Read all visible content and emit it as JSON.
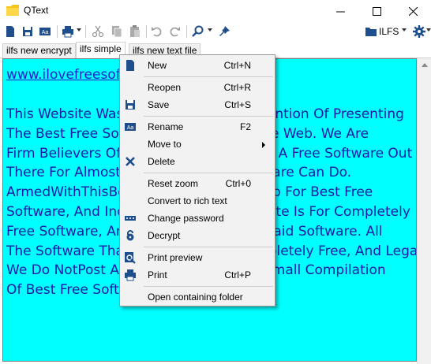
{
  "window": {
    "title": "QText",
    "min_icon": "minimize-icon",
    "max_icon": "maximize-icon",
    "close_icon": "close-icon"
  },
  "toolbar": {
    "ilfs_label": "ILFS"
  },
  "tabs": [
    {
      "label": "ilfs new encrypt"
    },
    {
      "label": "ilfs simple"
    },
    {
      "label": "ilfs new text file"
    }
  ],
  "editor": {
    "link": "www.ilovefreesoftware.com",
    "lines": [
      "This Website Was Created With The Intention Of Presenting",
      "The Best Free Software Available On The Web. We Are",
      "Firm Believers Of The Fact That There Is A Free Software Out",
      "There For Almost Anything A Paid Software Can Do.",
      "ArmedWithThisBelief, We Scour The Web For Best Free",
      "Software, And Include Them. This Website Is For Completely",
      "Free Software, And We Do Not Include Paid Software. All",
      "The Software That We Review Are Completely Free, And Legal.",
      "We Do NotPost Any Cracks. Enjoy Our Small Compilation",
      "Of Best Free Software."
    ]
  },
  "menu": {
    "items": [
      {
        "label": "New",
        "shortcut": "Ctrl+N",
        "icon": "new-file-icon"
      },
      {
        "label": "Reopen",
        "shortcut": "Ctrl+R",
        "icon": ""
      },
      {
        "label": "Save",
        "shortcut": "Ctrl+S",
        "icon": "save-icon"
      },
      {
        "label": "Rename",
        "shortcut": "F2",
        "icon": "rename-icon"
      },
      {
        "label": "Move to",
        "shortcut": "",
        "icon": ""
      },
      {
        "label": "Delete",
        "shortcut": "",
        "icon": "delete-icon"
      },
      {
        "label": "Reset zoom",
        "shortcut": "Ctrl+0",
        "icon": ""
      },
      {
        "label": "Convert to rich text",
        "shortcut": "",
        "icon": ""
      },
      {
        "label": "Change password",
        "shortcut": "",
        "icon": "password-icon"
      },
      {
        "label": "Decrypt",
        "shortcut": "",
        "icon": "decrypt-icon"
      },
      {
        "label": "Print preview",
        "shortcut": "",
        "icon": "print-preview-icon"
      },
      {
        "label": "Print",
        "shortcut": "Ctrl+P",
        "icon": "print-icon"
      },
      {
        "label": "Open containing folder",
        "shortcut": "",
        "icon": ""
      }
    ]
  },
  "colors": {
    "editor_bg": "#00ffff",
    "editor_text": "#1a1aa8",
    "link": "#2222cc",
    "icon_blue": "#1f4e8c"
  }
}
